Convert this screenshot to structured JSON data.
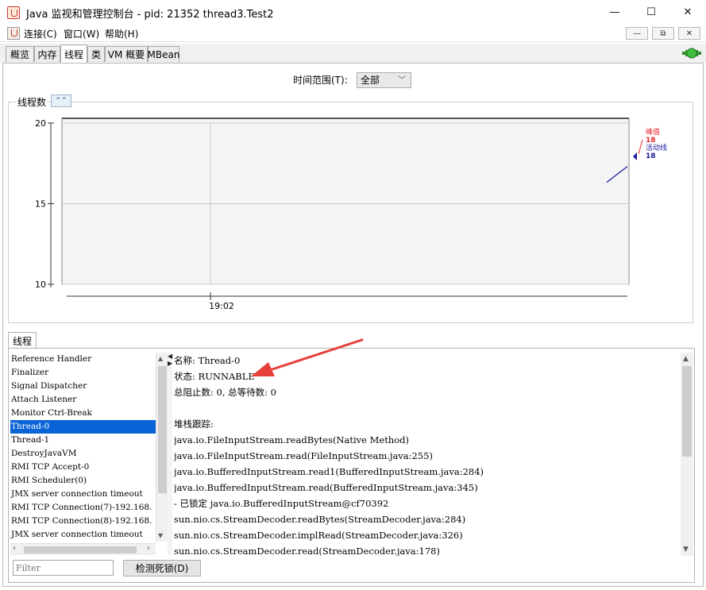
{
  "window": {
    "title": "Java 监视和管理控制台 - pid: 21352 thread3.Test2",
    "minimize": "—",
    "maximize": "☐",
    "close": "✕"
  },
  "menu": {
    "items": [
      "连接(C)",
      "窗口(W)",
      "帮助(H)"
    ],
    "mdi_buttons": [
      "—",
      "⧉",
      "✕"
    ]
  },
  "tabs": [
    "概览",
    "内存",
    "线程",
    "类",
    "VM 概要",
    "MBean"
  ],
  "active_tab": "线程",
  "time_range": {
    "label": "时间范围(T):",
    "value": "全部"
  },
  "chart_group_title": "线程数",
  "chart_data": {
    "type": "line",
    "title": "",
    "y_ticks": [
      "20",
      "15",
      "10"
    ],
    "ylim": [
      10,
      20
    ],
    "x_ticks": [
      "19:02"
    ],
    "grid": true,
    "series": [
      {
        "name": "峰值",
        "latest": "18",
        "color": "#e8262a"
      },
      {
        "name": "活动线程",
        "latest": "18",
        "color": "#1a1a9a"
      }
    ],
    "legend": "right"
  },
  "threads_tab_label": "线程",
  "thread_list": [
    "Reference Handler",
    "Finalizer",
    "Signal Dispatcher",
    "Attach Listener",
    "Monitor Ctrl-Break",
    "Thread-0",
    "Thread-1",
    "DestroyJavaVM",
    "RMI TCP Accept-0",
    "RMI Scheduler(0)",
    "JMX server connection timeout",
    "RMI TCP Connection(7)-192.168.",
    "RMI TCP Connection(8)-192.168.",
    "JMX server connection timeout"
  ],
  "selected_thread": "Thread-0",
  "detail": [
    "名称: Thread-0",
    "状态: RUNNABLE",
    "总阻止数: 0, 总等待数: 0",
    "",
    "堆栈跟踪:",
    "java.io.FileInputStream.readBytes(Native Method)",
    "java.io.FileInputStream.read(FileInputStream.java:255)",
    "java.io.BufferedInputStream.read1(BufferedInputStream.java:284)",
    "java.io.BufferedInputStream.read(BufferedInputStream.java:345)",
    "   - 已锁定 java.io.BufferedInputStream@cf70392",
    "sun.nio.cs.StreamDecoder.readBytes(StreamDecoder.java:284)",
    "sun.nio.cs.StreamDecoder.implRead(StreamDecoder.java:326)",
    "sun.nio.cs.StreamDecoder.read(StreamDecoder.java:178)"
  ],
  "filter_placeholder": "Filter",
  "deadlock_button": "检测死锁(D)",
  "colors": {
    "selection": "#0a64d8",
    "annotation_arrow": "#e8403a",
    "peak": "#e8262a",
    "live": "#1a1a9a"
  }
}
